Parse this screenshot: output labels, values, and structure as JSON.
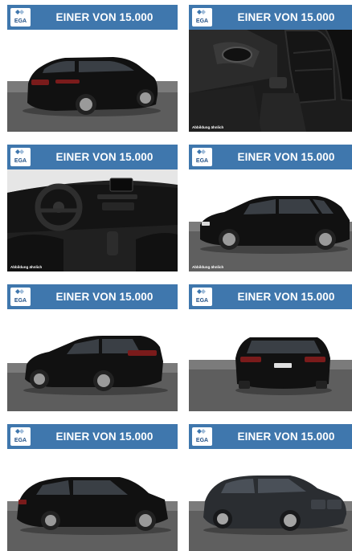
{
  "tiles": [
    {
      "banner": "EINER VON 15.000",
      "badge": "EGA",
      "view": "exterior-rear-three-quarter",
      "caption": ""
    },
    {
      "banner": "EINER VON 15.000",
      "badge": "EGA",
      "view": "interior-front-seats",
      "caption": "Abbildung ähnlich"
    },
    {
      "banner": "EINER VON 15.000",
      "badge": "EGA",
      "view": "interior-dashboard",
      "caption": "Abbildung ähnlich"
    },
    {
      "banner": "EINER VON 15.000",
      "badge": "EGA",
      "view": "exterior-side",
      "caption": "Abbildung ähnlich"
    },
    {
      "banner": "EINER VON 15.000",
      "badge": "EGA",
      "view": "exterior-rear-side",
      "caption": ""
    },
    {
      "banner": "EINER VON 15.000",
      "badge": "EGA",
      "view": "exterior-rear",
      "caption": ""
    },
    {
      "banner": "EINER VON 15.000",
      "badge": "EGA",
      "view": "exterior-front-side",
      "caption": ""
    },
    {
      "banner": "EINER VON 15.000",
      "badge": "EGA",
      "view": "exterior-front-three-quarter",
      "caption": ""
    }
  ],
  "colors": {
    "banner": "#3f77ad",
    "badge_text": "#1f4f86",
    "car": "#111111"
  }
}
